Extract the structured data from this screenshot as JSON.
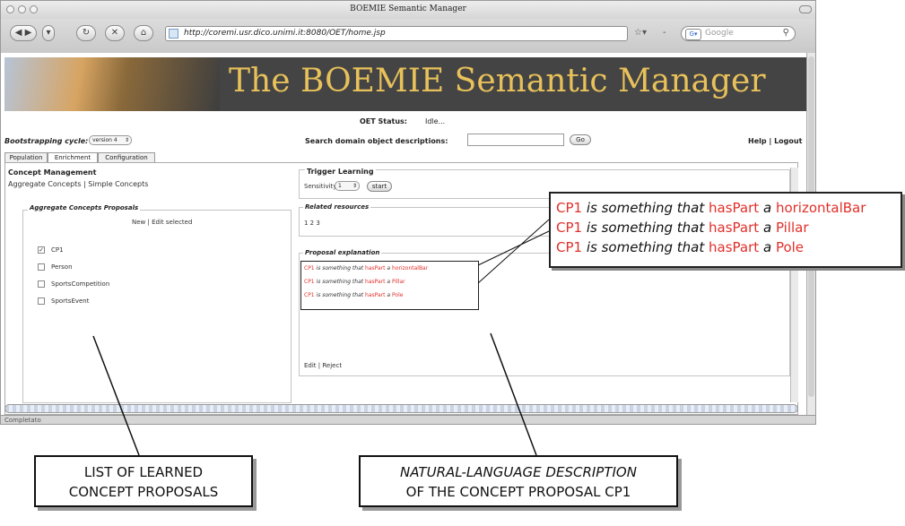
{
  "window": {
    "title": "BOEMIE Semantic Manager"
  },
  "toolbar": {
    "url": "http://coremi.usr.dico.unimi.it:8080/OET/home.jsp",
    "search_placeholder": "Google"
  },
  "page": {
    "banner_title": "The BOEMIE Semantic Manager",
    "status_label": "OET Status:",
    "status_value": "Idle...",
    "bootstrapping_label": "Bootstrapping cycle:",
    "bootstrapping_value": "version 4",
    "search_label": "Search domain object descriptions:",
    "go_label": "Go",
    "help_logout": "Help | Logout"
  },
  "tabs": [
    {
      "label": "Population"
    },
    {
      "label": "Enrichment"
    },
    {
      "label": "Configuration"
    }
  ],
  "concept_mgmt": {
    "title": "Concept Management",
    "aggregate_link": "Aggregate Concepts",
    "separator": "|",
    "simple_link": "Simple Concepts"
  },
  "proposals": {
    "legend": "Aggregate Concepts Proposals",
    "new_label": "New",
    "edit_selected_label": "Edit selected",
    "items": [
      {
        "label": "CP1",
        "checked": true
      },
      {
        "label": "Person",
        "checked": false
      },
      {
        "label": "SportsCompetition",
        "checked": false
      },
      {
        "label": "SportsEvent",
        "checked": false
      }
    ]
  },
  "trigger": {
    "title": "Trigger Learning",
    "sensitivity_label": "Sensitivity",
    "sensitivity_value": "1",
    "start_label": "start"
  },
  "related": {
    "legend": "Related resources",
    "value": "1 2 3"
  },
  "explanation": {
    "legend": "Proposal explanation",
    "lines": [
      {
        "subject": "CP1",
        "phrase": "is something that",
        "relation": "hasPart",
        "article": "a",
        "object": "horizontalBar"
      },
      {
        "subject": "CP1",
        "phrase": "is something that",
        "relation": "hasPart",
        "article": "a",
        "object": "Pillar"
      },
      {
        "subject": "CP1",
        "phrase": "is something that",
        "relation": "hasPart",
        "article": "a",
        "object": "Pole"
      }
    ],
    "edit_label": "Edit",
    "reject_label": "Reject"
  },
  "statusbar": {
    "text": "Completato"
  },
  "callouts": {
    "left_line1": "LIST OF LEARNED",
    "left_line2": "CONCEPT PROPOSALS",
    "right_line1": "NATURAL-LANGUAGE DESCRIPTION",
    "right_line2": "OF THE CONCEPT PROPOSAL CP1"
  },
  "colors": {
    "accent_red": "#e0302a",
    "banner_gold": "#e8c15a"
  }
}
